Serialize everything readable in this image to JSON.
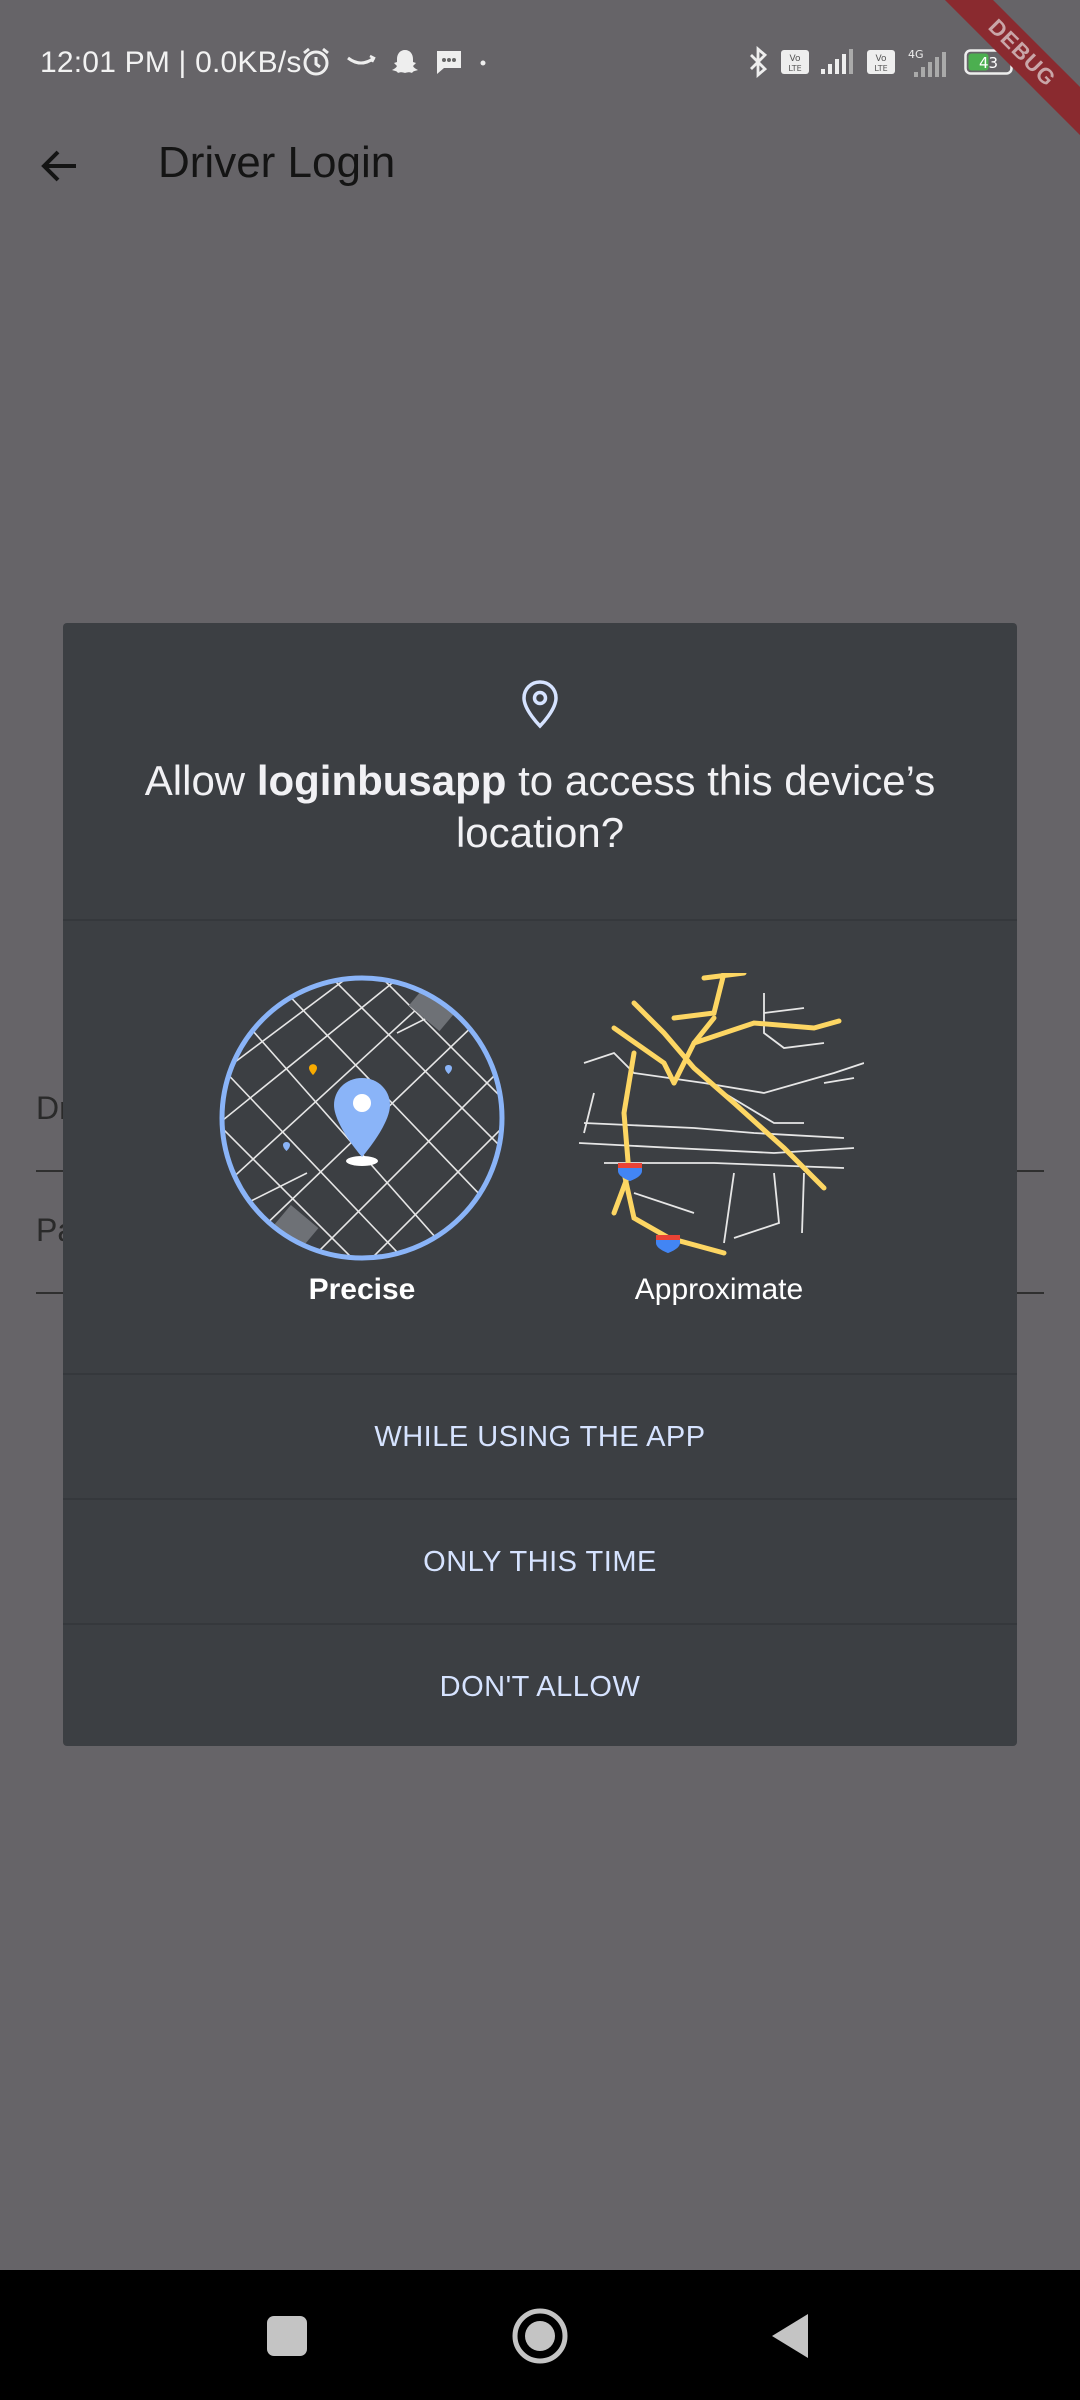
{
  "status_bar": {
    "time_text": "12:01 PM | 0.0KB/s",
    "battery_level": "43",
    "network_type": "4G"
  },
  "debug_banner": "DEBUG",
  "app_bar": {
    "title": "Driver Login"
  },
  "background_form": {
    "field1_partial": "Dr",
    "field2_partial": "Pa"
  },
  "dialog": {
    "title_prefix": "Allow ",
    "app_name": "loginbusapp",
    "title_suffix": " to access this device’s location?",
    "options": [
      {
        "label": "Precise",
        "selected": true
      },
      {
        "label": "Approximate",
        "selected": false
      }
    ],
    "buttons": [
      {
        "label": "WHILE USING THE APP"
      },
      {
        "label": "ONLY THIS TIME"
      },
      {
        "label": "DON'T ALLOW"
      }
    ]
  },
  "colors": {
    "scrim": "#666468",
    "dialog_bg": "#3c3f43",
    "accent": "#8ab4f8",
    "button_text": "#d6e3ff",
    "road_yellow": "#fdd663"
  }
}
